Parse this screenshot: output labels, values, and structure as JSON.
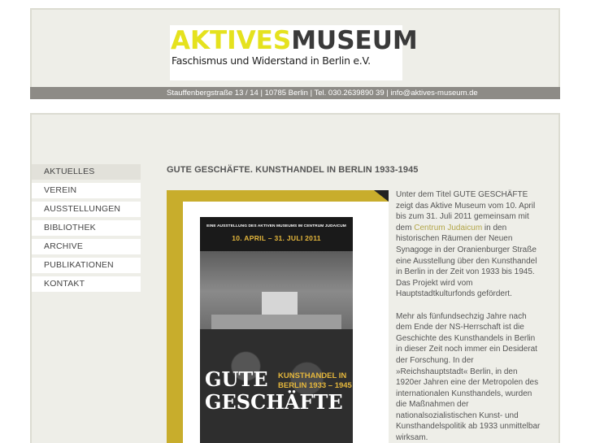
{
  "header": {
    "logo_part1": "AKTIVES",
    "logo_part2": "MUSEUM",
    "logo_subtitle": "Faschismus und Widerstand in Berlin e.V.",
    "address": "Stauffenbergstraße 13 / 14 | 10785 Berlin | Tel. 030.2639890 39 | info@aktives-museum.de"
  },
  "sidebar": {
    "items": [
      {
        "label": "AKTUELLES"
      },
      {
        "label": "VEREIN"
      },
      {
        "label": "AUSSTELLUNGEN"
      },
      {
        "label": "BIBLIOTHEK"
      },
      {
        "label": "ARCHIVE"
      },
      {
        "label": "PUBLIKATIONEN"
      },
      {
        "label": "KONTAKT"
      }
    ]
  },
  "main": {
    "title": "GUTE GESCHÄFTE. KUNSTHANDEL IN BERLIN 1933-1945",
    "poster": {
      "top_line": "EINE AUSSTELLUNG DES AKTIVEN MUSEUMS IM CENTRUM JUDAICUM",
      "dates": "10. APRIL – 31. JULI 2011",
      "subtitle_1": "KUNSTHANDEL IN",
      "subtitle_2": "BERLIN 1933 – 1945",
      "big_1": "GUTE",
      "big_2": "GESCHÄFTE"
    },
    "paragraph1_before": "Unter dem Titel GUTE GESCHÄFTE zeigt das Aktive Museum vom 10. April bis zum 31. Juli 2011 gemeinsam mit dem ",
    "paragraph1_link": "Centrum Judaicum",
    "paragraph1_after": " in den historischen Räumen der Neuen Synagoge in der Oranienburger Straße eine Ausstellung über den Kunsthandel in Berlin in der Zeit von 1933 bis 1945. Das Projekt wird vom Hauptstadtkulturfonds gefördert.",
    "paragraph2": "Mehr als fünfundsechzig Jahre nach dem Ende der NS-Herrschaft ist die Geschichte des Kunsthandels in Berlin in dieser Zeit noch immer ein Desiderat der Forschung. In der »Reichshauptstadt« Berlin, in den 1920er Jahren eine der Metropolen des internationalen Kunsthandels, wurden die Maßnahmen der nationalsozialistischen Kunst- und Kunsthandelspolitik ab 1933 unmittelbar wirksam."
  }
}
